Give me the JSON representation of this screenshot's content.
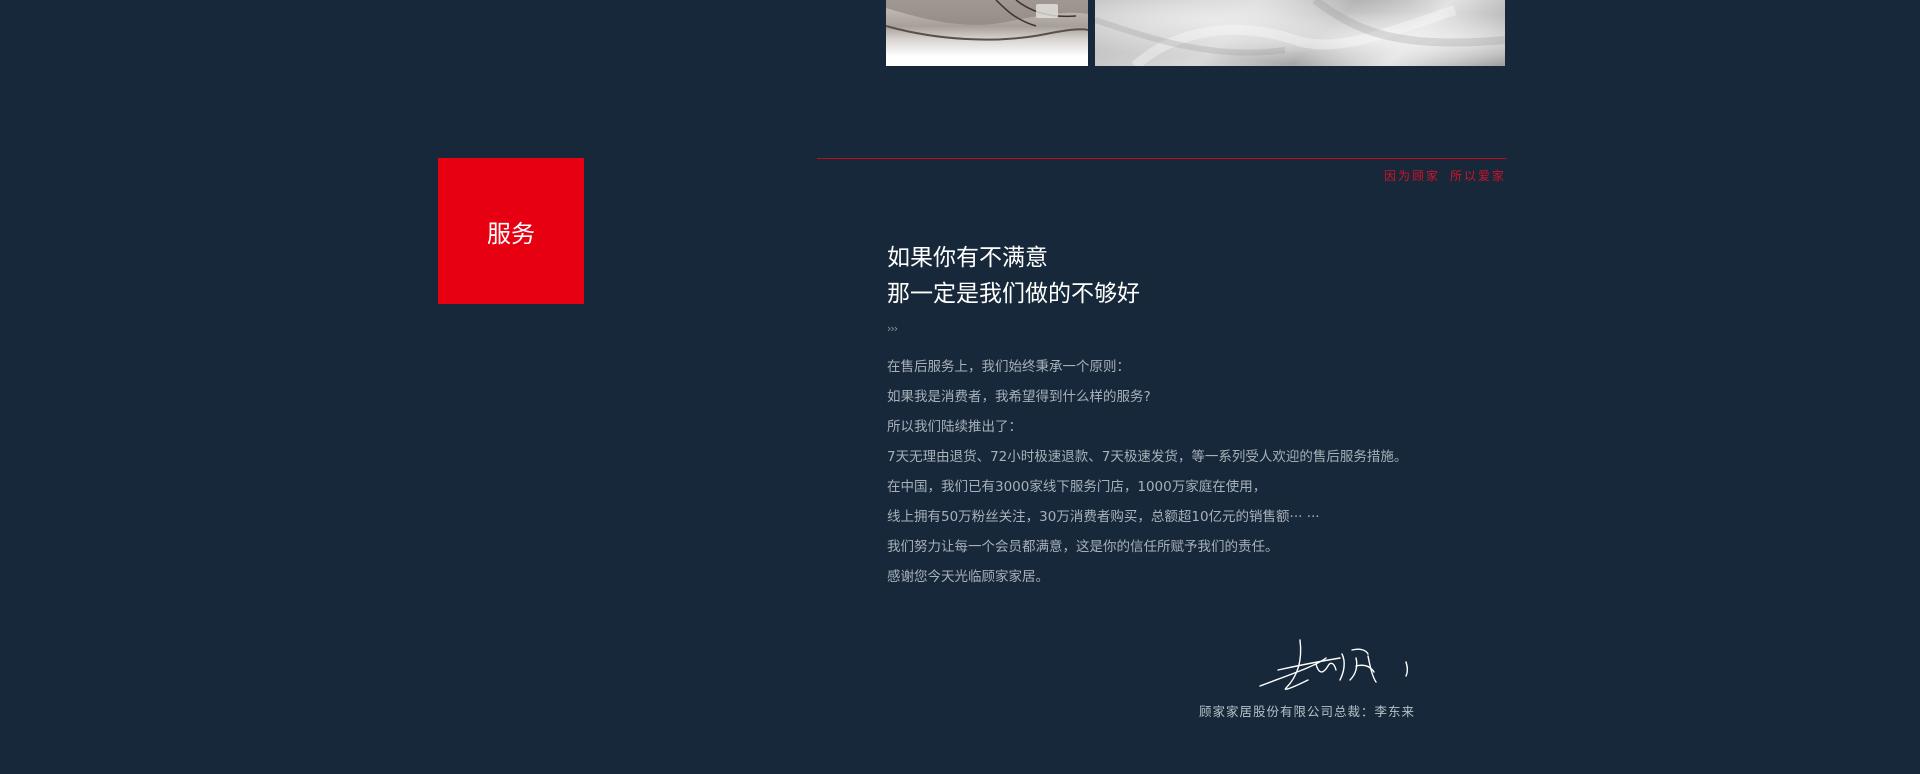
{
  "images": {
    "top_left_photo": "white leather sofa armrest photo",
    "top_right_photo": "white leather texture photo"
  },
  "service_block": {
    "label": "服务",
    "color": "#e60012"
  },
  "slogan": {
    "part1": "因为顾家",
    "part2": "所以爱家",
    "color": "#d2122a"
  },
  "headline": {
    "line1": "如果你有不满意",
    "line2": "那一定是我们做的不够好"
  },
  "arrows": "›››",
  "body_lines": [
    "在售后服务上，我们始终秉承一个原则：",
    "如果我是消费者，我希望得到什么样的服务?",
    "所以我们陆续推出了：",
    "7天无理由退货、72小时极速退款、7天极速发货，等一系列受人欢迎的售后服务措施。",
    "在中国，我们已有3000家线下服务门店，1000万家庭在使用，",
    "线上拥有50万粉丝关注，30万消费者购买，总额超10亿元的销售额···  ···",
    "我们努力让每一个会员都满意，这是你的信任所赋予我们的责任。",
    "感谢您今天光临顾家家居。"
  ],
  "signature": {
    "caption": "顾家家居股份有限公司总裁：李东来"
  },
  "colors": {
    "background": "#162839",
    "accent_red": "#e60012"
  }
}
